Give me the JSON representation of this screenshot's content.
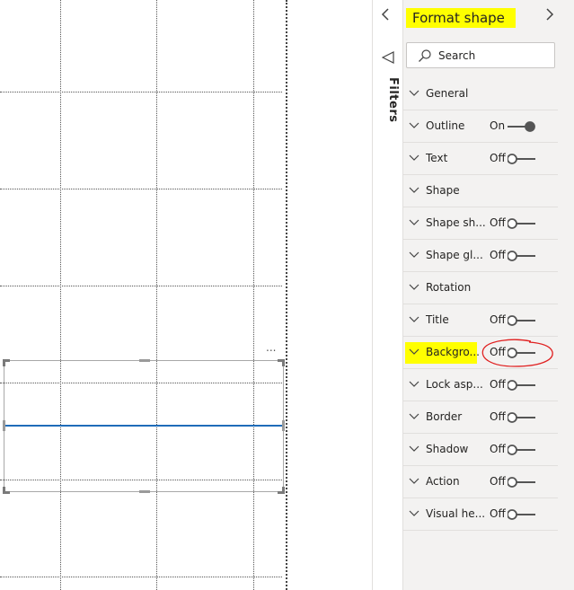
{
  "pane": {
    "title": "Format shape",
    "search_placeholder": "Search",
    "filters_label": "Filters"
  },
  "sections": [
    {
      "label": "General",
      "state": ""
    },
    {
      "label": "Outline",
      "state": "On"
    },
    {
      "label": "Text",
      "state": "Off"
    },
    {
      "label": "Shape",
      "state": ""
    },
    {
      "label": "Shape sh...",
      "state": "Off"
    },
    {
      "label": "Shape gl...",
      "state": "Off"
    },
    {
      "label": "Rotation",
      "state": ""
    },
    {
      "label": "Title",
      "state": "Off"
    },
    {
      "label": "Backgro...",
      "state": "Off"
    },
    {
      "label": "Lock asp...",
      "state": "Off"
    },
    {
      "label": "Border",
      "state": "Off"
    },
    {
      "label": "Shadow",
      "state": "Off"
    },
    {
      "label": "Action",
      "state": "Off"
    },
    {
      "label": "Visual he...",
      "state": "Off"
    }
  ],
  "canvas": {
    "more_options": "..."
  },
  "colors": {
    "highlight": "#ffff00",
    "annotation": "#e02020",
    "shape_line": "#1f6cb9",
    "pane_bg": "#f3f2f1"
  },
  "icons": [
    "chevron-left-icon",
    "chevron-right-icon",
    "filter-icon",
    "search-icon",
    "chevron-down-icon",
    "toggle-switch-icon"
  ]
}
